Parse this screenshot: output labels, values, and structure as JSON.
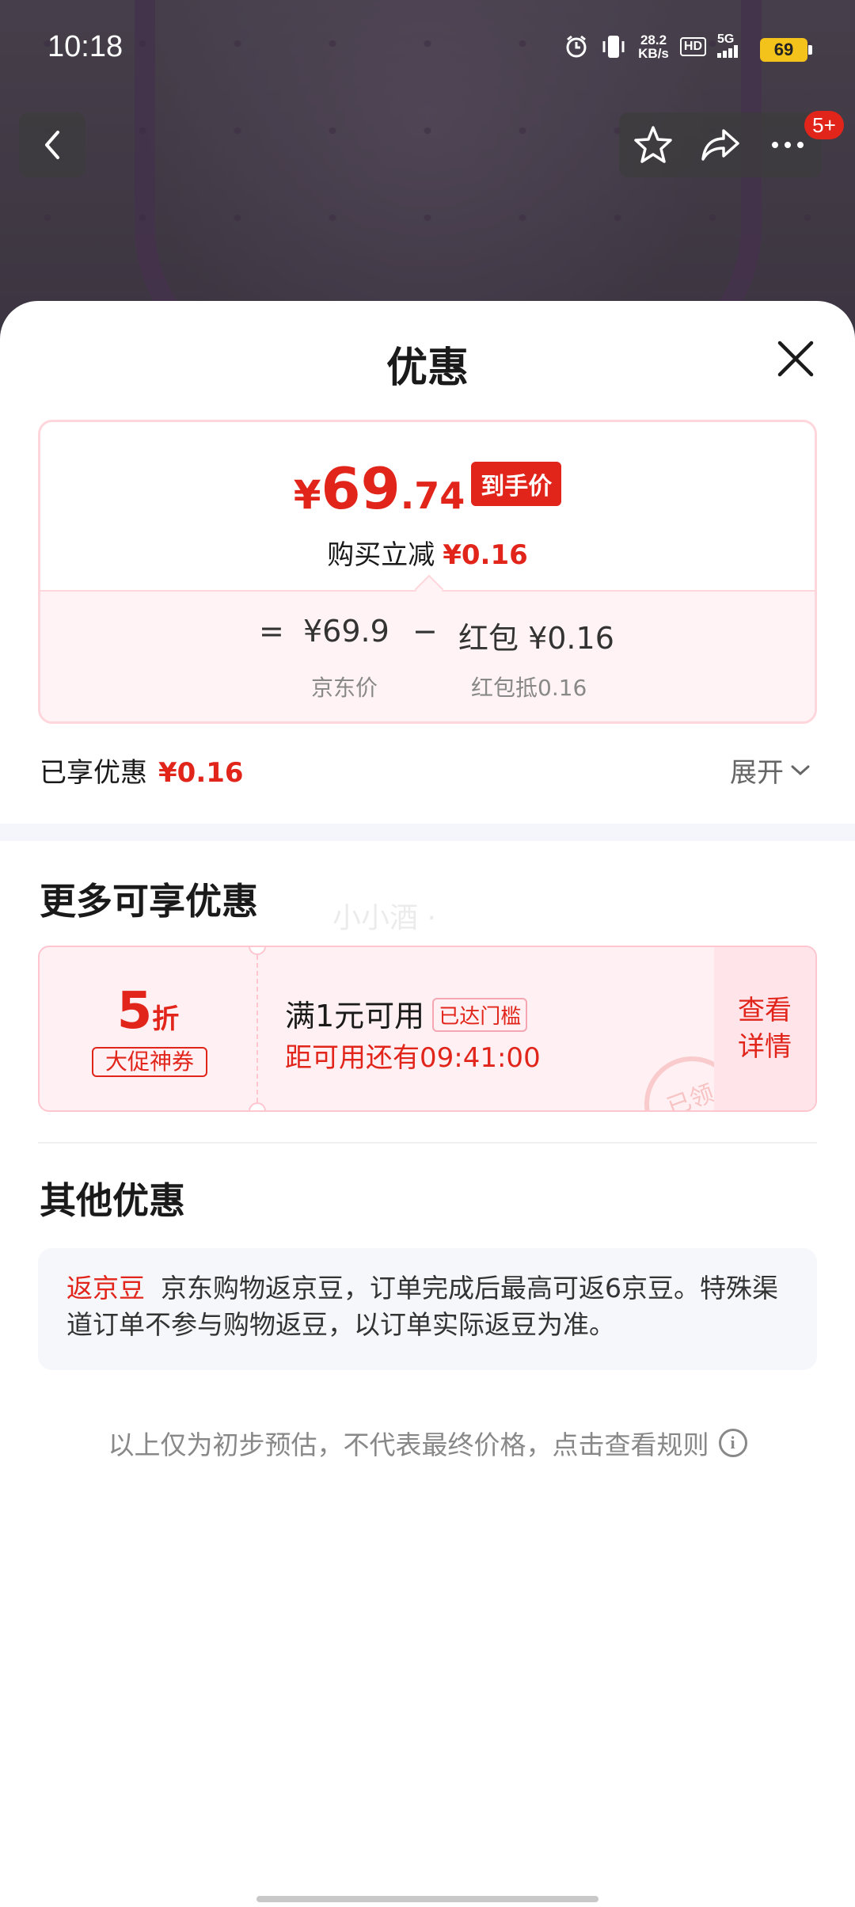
{
  "status_bar": {
    "time": "10:18",
    "net_speed_value": "28.2",
    "net_speed_unit": "KB/s",
    "hd_label": "HD",
    "network_label": "5G",
    "battery": "69"
  },
  "nav": {
    "badge": "5+"
  },
  "sheet": {
    "title": "优惠"
  },
  "price": {
    "currency": "¥",
    "integer": "69",
    "decimal": ".74",
    "tag": "到手价",
    "reduce_label": "购买立减",
    "reduce_value": "¥0.16",
    "formula_eq": "=",
    "jd_price": "¥69.9",
    "formula_minus": "−",
    "hongbao": "红包 ¥0.16",
    "jd_price_label": "京东价",
    "hongbao_label": "红包抵0.16"
  },
  "enjoyed": {
    "label": "已享优惠",
    "value": "¥0.16",
    "expand": "展开"
  },
  "more": {
    "title": "更多可享优惠",
    "watermark": "小小酒 ·"
  },
  "coupon": {
    "discount_number": "5",
    "discount_unit": "折",
    "type": "大促神券",
    "condition": "满1元可用",
    "reached": "已达门槛",
    "countdown": "距可用还有09:41:00",
    "detail": "查看详情",
    "stamp": "已领"
  },
  "other": {
    "title": "其他优惠",
    "tag": "返京豆",
    "text": "京东购物返京豆，订单完成后最高可返6京豆。特殊渠道订单不参与购物返豆，以订单实际返豆为准。"
  },
  "footnote": {
    "text": "以上仅为初步预估，不代表最终价格，点击查看规则",
    "icon": "i"
  },
  "colors": {
    "accent": "#e1251b",
    "panel_bg": "#fff3f5",
    "section_bg": "#f5f7fb"
  }
}
